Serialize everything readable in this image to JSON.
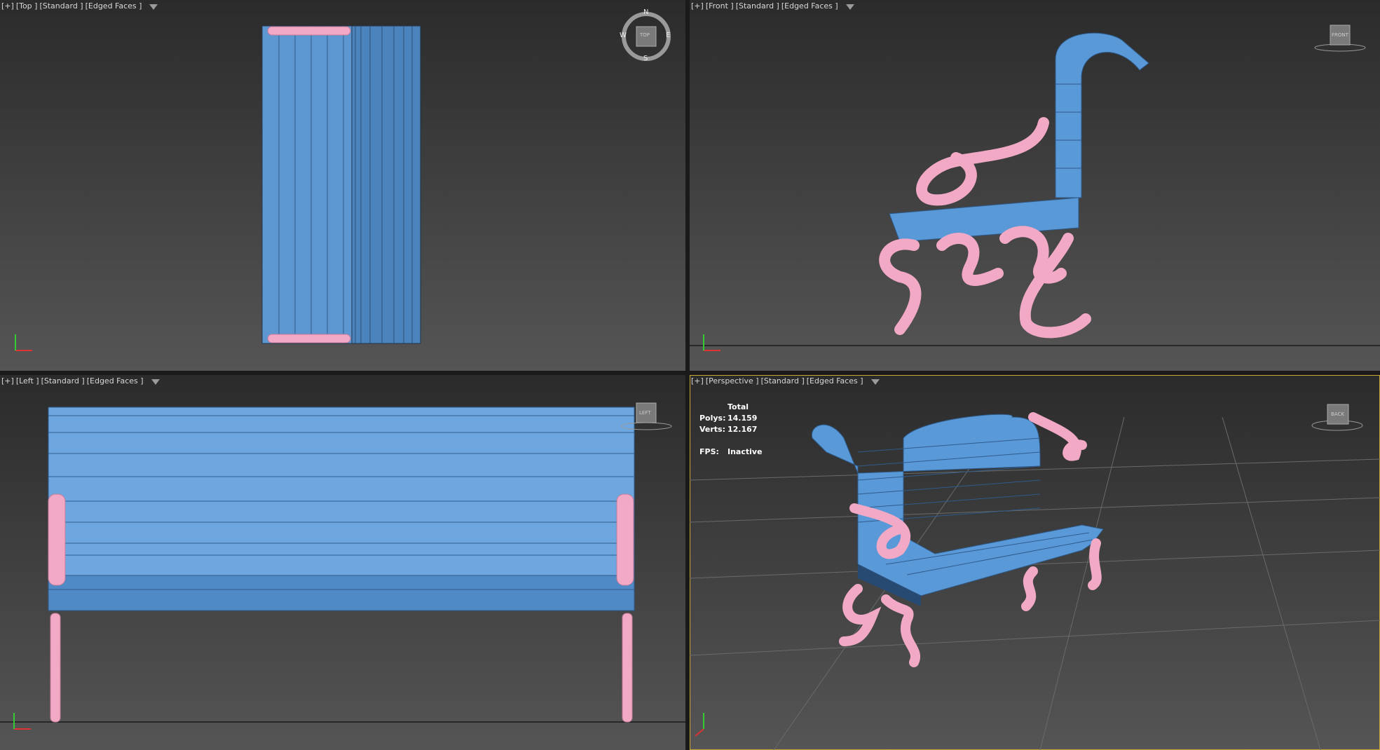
{
  "viewports": {
    "top": {
      "plus": "[+]",
      "view": "[Top ]",
      "shading": "[Standard ]",
      "edges": "[Edged Faces ]",
      "compass": {
        "n": "N",
        "s": "S",
        "e": "E",
        "w": "W",
        "cube": "TOP"
      }
    },
    "front": {
      "plus": "[+]",
      "view": "[Front ]",
      "shading": "[Standard ]",
      "edges": "[Edged Faces ]",
      "cube": "FRONT"
    },
    "left": {
      "plus": "[+]",
      "view": "[Left ]",
      "shading": "[Standard ]",
      "edges": "[Edged Faces ]",
      "cube": "LEFT"
    },
    "perspective": {
      "plus": "[+]",
      "view": "[Perspective ]",
      "shading": "[Standard ]",
      "edges": "[Edged Faces ]",
      "cube": "BACK"
    }
  },
  "stats": {
    "total_label": "Total",
    "polys_label": "Polys:",
    "polys_value": "14.159",
    "verts_label": "Verts:",
    "verts_value": "12.167",
    "fps_label": "FPS:",
    "fps_value": "Inactive"
  },
  "colors": {
    "bench_blue": "#5b97d4",
    "leg_pink": "#f1a9c5",
    "active_border": "#c9a83a",
    "bg_top": "#2b2b2b",
    "bg_bottom": "#555555"
  }
}
